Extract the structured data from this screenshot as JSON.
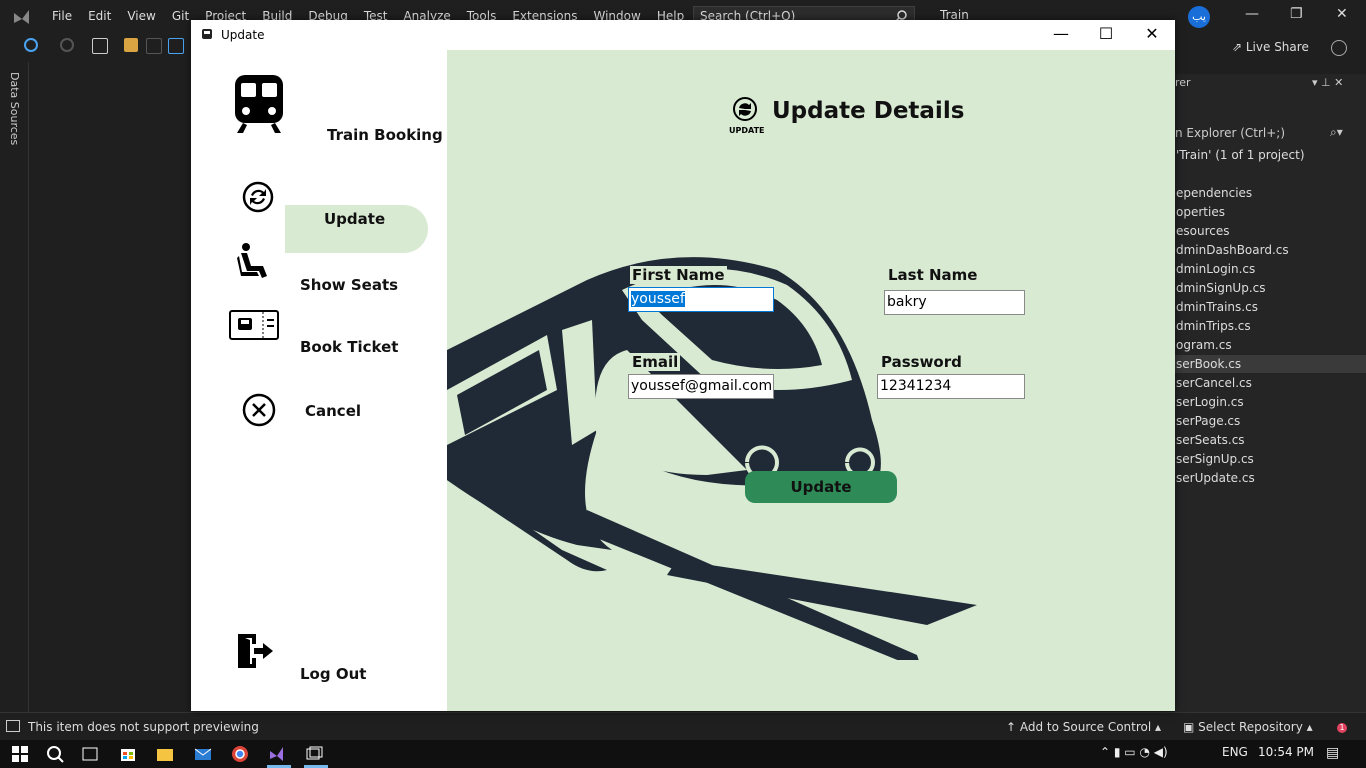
{
  "vs": {
    "menu": [
      "File",
      "Edit",
      "View",
      "Git",
      "Project",
      "Build",
      "Debug",
      "Test",
      "Analyze",
      "Tools",
      "Extensions",
      "Window",
      "Help"
    ],
    "search_placeholder": "Search (Ctrl+Q)",
    "project_name": "Train",
    "avatar_initials": "یب",
    "live_share": "Live Share",
    "data_sources": "Data Sources",
    "solution": {
      "header": "rer",
      "search": "n Explorer (Ctrl+;)",
      "solution_line": "'Train' (1 of 1 project)",
      "items": [
        "ependencies",
        "operties",
        "esources",
        "dminDashBoard.cs",
        "dminLogin.cs",
        "dminSignUp.cs",
        "dminTrains.cs",
        "dminTrips.cs",
        "ogram.cs",
        "serBook.cs",
        "serCancel.cs",
        "serLogin.cs",
        "serPage.cs",
        "serSeats.cs",
        "serSignUp.cs",
        "serUpdate.cs"
      ]
    },
    "status": {
      "message": "This item does not support previewing",
      "source_control": "Add to Source Control",
      "repo": "Select Repository",
      "notif_count": "1"
    },
    "taskbar": {
      "lang": "ENG",
      "time": "10:54 PM"
    }
  },
  "dialog": {
    "title": "Update",
    "brand": "Train Booking",
    "nav": {
      "update": "Update",
      "show_seats": "Show Seats",
      "book_ticket": "Book Ticket",
      "cancel": "Cancel",
      "logout": "Log Out"
    },
    "heading": "Update Details",
    "heading_icon_text": "UPDATE",
    "form": {
      "first_name_label": "First Name",
      "first_name": "youssef",
      "last_name_label": "Last Name",
      "last_name": "bakry",
      "email_label": "Email",
      "email": "youssef@gmail.com",
      "password_label": "Password",
      "password": "12341234",
      "submit": "Update"
    },
    "colors": {
      "main_bg": "#d9ead3",
      "button": "#2e8b57",
      "train": "#1f2a36"
    }
  }
}
